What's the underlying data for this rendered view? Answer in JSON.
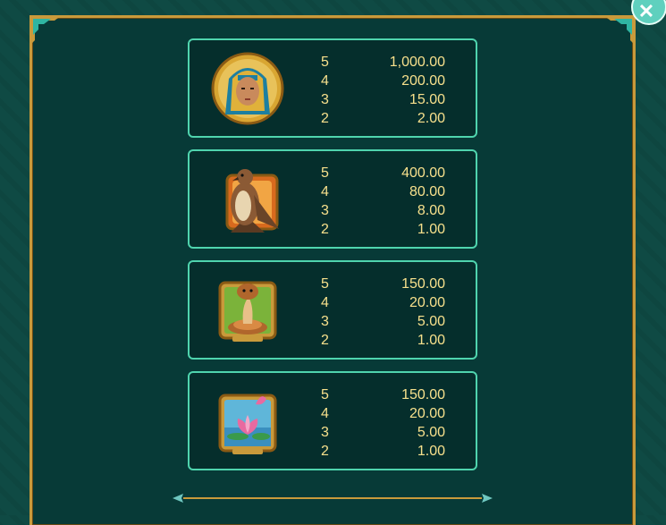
{
  "close_icon": "close-icon",
  "cards": [
    {
      "symbol": "pharaoh-icon",
      "payouts": [
        {
          "count": "5",
          "value": "1,000.00"
        },
        {
          "count": "4",
          "value": "200.00"
        },
        {
          "count": "3",
          "value": "15.00"
        },
        {
          "count": "2",
          "value": "2.00"
        }
      ]
    },
    {
      "symbol": "falcon-icon",
      "payouts": [
        {
          "count": "5",
          "value": "400.00"
        },
        {
          "count": "4",
          "value": "80.00"
        },
        {
          "count": "3",
          "value": "8.00"
        },
        {
          "count": "2",
          "value": "1.00"
        }
      ]
    },
    {
      "symbol": "cobra-icon",
      "payouts": [
        {
          "count": "5",
          "value": "150.00"
        },
        {
          "count": "4",
          "value": "20.00"
        },
        {
          "count": "3",
          "value": "5.00"
        },
        {
          "count": "2",
          "value": "1.00"
        }
      ]
    },
    {
      "symbol": "lotus-icon",
      "payouts": [
        {
          "count": "5",
          "value": "150.00"
        },
        {
          "count": "4",
          "value": "20.00"
        },
        {
          "count": "3",
          "value": "5.00"
        },
        {
          "count": "2",
          "value": "1.00"
        }
      ]
    }
  ],
  "colors": {
    "accent": "#4fd4ae",
    "gold": "#c99a3b",
    "text": "#f7e08c",
    "panel": "#073a37"
  }
}
